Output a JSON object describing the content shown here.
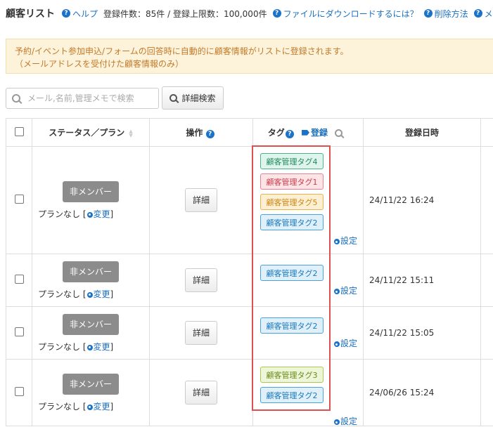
{
  "header": {
    "title": "顧客リスト",
    "help": "ヘルプ",
    "count_text": "登録件数：85件 / 登録上限数：100,000件",
    "download_help": "ファイルにダウンロードするには？",
    "delete_help": "削除方法",
    "menu_help": "メン"
  },
  "notice": {
    "line1": "予約/イベント参加申込/フォームの回答時に自動的に顧客情報がリストに登録されます。",
    "line2": "（メールアドレスを受付けた顧客情報のみ）"
  },
  "search": {
    "placeholder": "メール,名前,管理メモで検索",
    "advanced_button": "詳細検索"
  },
  "table": {
    "columns": {
      "status": "ステータス／プラン",
      "action": "操作",
      "tag": "タグ",
      "tag_register": "登録",
      "registered_at": "登録日時"
    },
    "rows": [
      {
        "status": "非メンバー",
        "plan": "プランなし [",
        "change": "変更",
        "plan_close": "]",
        "detail": "詳細",
        "tags": [
          {
            "label": "顧客管理タグ4",
            "color": "green"
          },
          {
            "label": "顧客管理タグ1",
            "color": "pink"
          },
          {
            "label": "顧客管理タグ5",
            "color": "orange"
          },
          {
            "label": "顧客管理タグ2",
            "color": "blue"
          }
        ],
        "setting": "設定",
        "date": "24/11/22 16:24"
      },
      {
        "status": "非メンバー",
        "plan": "プランなし [",
        "change": "変更",
        "plan_close": "]",
        "detail": "詳細",
        "tags": [
          {
            "label": "顧客管理タグ2",
            "color": "blue"
          }
        ],
        "setting": "設定",
        "date": "24/11/22 15:11"
      },
      {
        "status": "非メンバー",
        "plan": "プランなし [",
        "change": "変更",
        "plan_close": "]",
        "detail": "詳細",
        "tags": [
          {
            "label": "顧客管理タグ2",
            "color": "blue"
          }
        ],
        "setting": "設定",
        "date": "24/11/22 15:05"
      },
      {
        "status": "非メンバー",
        "plan": "プランなし [",
        "change": "変更",
        "plan_close": "]",
        "detail": "詳細",
        "tags": [
          {
            "label": "顧客管理タグ3",
            "color": "lime"
          },
          {
            "label": "顧客管理タグ2",
            "color": "blue"
          }
        ],
        "setting": "設定",
        "date": "24/06/26 15:24"
      }
    ]
  },
  "colors": {
    "link": "#1a6fc0",
    "notice_bg": "#fdf3da",
    "notice_text": "#c27a2a",
    "highlight_border": "#e05050",
    "nonmember_bg": "#8c8c8c"
  }
}
